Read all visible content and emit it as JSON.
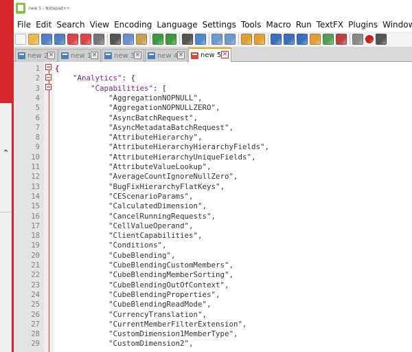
{
  "window": {
    "title": "new 5 - Notepad++"
  },
  "menu": [
    "File",
    "Edit",
    "Search",
    "View",
    "Encoding",
    "Language",
    "Settings",
    "Tools",
    "Macro",
    "Run",
    "TextFX",
    "Plugins",
    "Window",
    "?"
  ],
  "tabs": [
    {
      "label": "new 2",
      "active": false
    },
    {
      "label": "new 1",
      "active": false
    },
    {
      "label": "new 3",
      "active": false
    },
    {
      "label": "new 4",
      "active": false
    },
    {
      "label": "new 5",
      "active": true
    }
  ],
  "editor": {
    "lines": [
      {
        "n": "1",
        "indent": "",
        "parts": [
          [
            "{",
            "brace"
          ]
        ]
      },
      {
        "n": "2",
        "indent": "    ",
        "parts": [
          [
            "\"Analytics\"",
            "key"
          ],
          [
            ": {",
            "punct"
          ]
        ]
      },
      {
        "n": "3",
        "indent": "        ",
        "parts": [
          [
            "\"Capabilities\"",
            "key"
          ],
          [
            ": [",
            "punct"
          ]
        ]
      },
      {
        "n": "4",
        "indent": "            ",
        "parts": [
          [
            "\"AggregationNOPNULL\",",
            "str"
          ]
        ]
      },
      {
        "n": "5",
        "indent": "            ",
        "parts": [
          [
            "\"AggregationNOPNULLZERO\",",
            "str"
          ]
        ]
      },
      {
        "n": "6",
        "indent": "            ",
        "parts": [
          [
            "\"AsyncBatchRequest\",",
            "str"
          ]
        ]
      },
      {
        "n": "7",
        "indent": "            ",
        "parts": [
          [
            "\"AsyncMetadataBatchRequest\",",
            "str"
          ]
        ]
      },
      {
        "n": "8",
        "indent": "            ",
        "parts": [
          [
            "\"AttributeHierarchy\",",
            "str"
          ]
        ]
      },
      {
        "n": "9",
        "indent": "            ",
        "parts": [
          [
            "\"AttributeHierarchyHierarchyFields\",",
            "str"
          ]
        ]
      },
      {
        "n": "10",
        "indent": "            ",
        "parts": [
          [
            "\"AttributeHierarchyUniqueFields\",",
            "str"
          ]
        ]
      },
      {
        "n": "11",
        "indent": "            ",
        "parts": [
          [
            "\"AttributeValueLookup\",",
            "str"
          ]
        ]
      },
      {
        "n": "12",
        "indent": "            ",
        "parts": [
          [
            "\"AverageCountIgnoreNullZero\",",
            "str"
          ]
        ]
      },
      {
        "n": "13",
        "indent": "            ",
        "parts": [
          [
            "\"BugFixHierarchyFlatKeys\",",
            "str"
          ]
        ]
      },
      {
        "n": "14",
        "indent": "            ",
        "parts": [
          [
            "\"CEScenarioParams\",",
            "str"
          ]
        ]
      },
      {
        "n": "15",
        "indent": "            ",
        "parts": [
          [
            "\"CalculatedDimension\",",
            "str"
          ]
        ]
      },
      {
        "n": "16",
        "indent": "            ",
        "parts": [
          [
            "\"CancelRunningRequests\",",
            "str"
          ]
        ]
      },
      {
        "n": "17",
        "indent": "            ",
        "parts": [
          [
            "\"CellValueOperand\",",
            "str"
          ]
        ]
      },
      {
        "n": "18",
        "indent": "            ",
        "parts": [
          [
            "\"ClientCapabilities\",",
            "str"
          ]
        ]
      },
      {
        "n": "19",
        "indent": "            ",
        "parts": [
          [
            "\"Conditions\",",
            "str"
          ]
        ]
      },
      {
        "n": "20",
        "indent": "            ",
        "parts": [
          [
            "\"CubeBlending\",",
            "str"
          ]
        ]
      },
      {
        "n": "21",
        "indent": "            ",
        "parts": [
          [
            "\"CubeBlendingCustomMembers\",",
            "str"
          ]
        ]
      },
      {
        "n": "22",
        "indent": "            ",
        "parts": [
          [
            "\"CubeBlendingMemberSorting\",",
            "str"
          ]
        ]
      },
      {
        "n": "23",
        "indent": "            ",
        "parts": [
          [
            "\"CubeBlendingOutOfContext\",",
            "str"
          ]
        ]
      },
      {
        "n": "24",
        "indent": "            ",
        "parts": [
          [
            "\"CubeBlendingProperties\",",
            "str"
          ]
        ]
      },
      {
        "n": "25",
        "indent": "            ",
        "parts": [
          [
            "\"CubeBlendingReadMode\",",
            "str"
          ]
        ]
      },
      {
        "n": "26",
        "indent": "            ",
        "parts": [
          [
            "\"CurrencyTranslation\",",
            "str"
          ]
        ]
      },
      {
        "n": "27",
        "indent": "            ",
        "parts": [
          [
            "\"CurrentMemberFilterExtension\",",
            "str"
          ]
        ]
      },
      {
        "n": "28",
        "indent": "            ",
        "parts": [
          [
            "\"CustomDimension1MemberType\",",
            "str"
          ]
        ]
      },
      {
        "n": "29",
        "indent": "            ",
        "parts": [
          [
            "\"CustomDimension2\",",
            "str"
          ]
        ]
      }
    ]
  },
  "toolbar": {
    "icons": [
      "new-file-icon",
      "open-file-icon",
      "save-icon",
      "save-all-icon",
      "close-icon",
      "close-all-icon",
      "print-icon",
      "cut-icon",
      "copy-icon",
      "paste-icon",
      "undo-icon",
      "redo-icon",
      "find-icon",
      "replace-icon",
      "zoom-in-icon",
      "zoom-out-icon",
      "sync-v-icon",
      "sync-h-icon",
      "word-wrap-icon",
      "show-all-chars-icon",
      "indent-guide-icon",
      "doc-map-icon",
      "function-list-icon",
      "folder-workspace-icon",
      "monitor-icon",
      "record-macro-icon",
      "stop-record-icon"
    ]
  },
  "colors": {
    "accent_red": "#d6262b",
    "json_key": "#7a1fa2",
    "active_tab_top": "#f6a200"
  }
}
